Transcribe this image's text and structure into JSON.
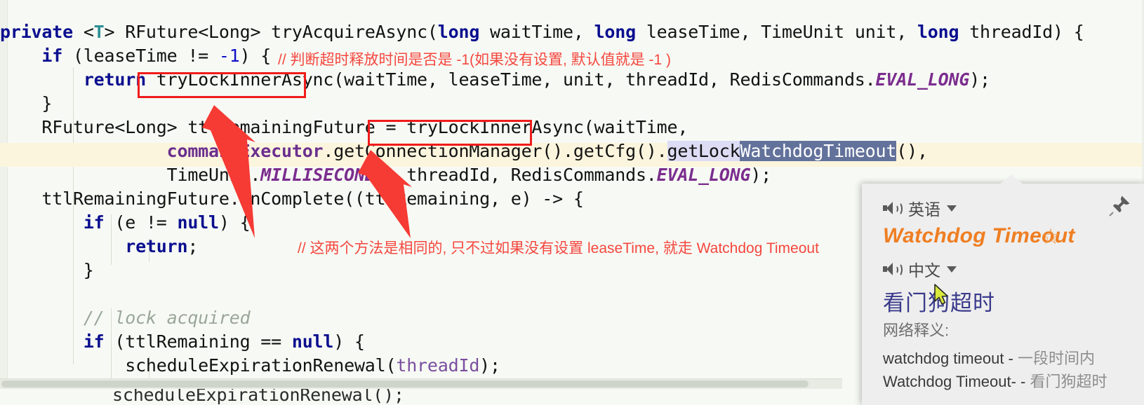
{
  "editor": {
    "language": "java",
    "background_color": "#f7faf4",
    "caret_line_color": "#fcf5dd",
    "lines": [
      {
        "id": "l1",
        "indent": 0,
        "text": "private <T> RFuture<Long> tryAcquireAsync(long waitTime, long leaseTime, TimeUnit unit, long threadId) {"
      },
      {
        "id": "l2",
        "indent": 1,
        "text": "if (leaseTime != -1) {"
      },
      {
        "id": "l3",
        "indent": 2,
        "text": "return tryLockInnerAsync(waitTime, leaseTime, unit, threadId, RedisCommands.EVAL_LONG);"
      },
      {
        "id": "l4",
        "indent": 1,
        "text": "}"
      },
      {
        "id": "l5",
        "indent": 1,
        "text": "RFuture<Long> ttlRemainingFuture = tryLockInnerAsync(waitTime,"
      },
      {
        "id": "l6",
        "indent": 5,
        "text": "commandExecutor.getConnectionManager().getCfg().getLockWatchdogTimeout(),",
        "highlighted": true
      },
      {
        "id": "l7",
        "indent": 5,
        "text": "TimeUnit.MILLISECONDS, threadId, RedisCommands.EVAL_LONG);"
      },
      {
        "id": "l8",
        "indent": 1,
        "text": "ttlRemainingFuture.onComplete((ttlRemaining, e) -> {"
      },
      {
        "id": "l9",
        "indent": 2,
        "text": "if (e != null) {"
      },
      {
        "id": "l10",
        "indent": 3,
        "text": "return;"
      },
      {
        "id": "l11",
        "indent": 2,
        "text": "}"
      },
      {
        "id": "l12",
        "indent": 2,
        "text": "// lock acquired"
      },
      {
        "id": "l13",
        "indent": 2,
        "text": "if (ttlRemaining == null) {"
      },
      {
        "id": "l14",
        "indent": 3,
        "text": "scheduleExpirationRenewal(threadId);"
      },
      {
        "id": "l15",
        "indent": 3,
        "text": "scheduleExpirationRenewal();"
      }
    ],
    "selected_text": "WatchdogTimeout",
    "soft_highlight_text": "getLock",
    "selection_color": "#63729b",
    "soft_highlight_color": "#dcdcf4"
  },
  "annotations": {
    "comment_inline": "// 判断超时释放时间是否是 -1(如果没有设置, 默认值就是 -1 )",
    "comment_note": "// 这两个方法是相同的, 只不过如果没有设置 leaseTime, 就走 Watchdog Timeout",
    "annotation_color": "#f4473f",
    "boxed_token_1": "tryLockInnerAsync",
    "boxed_token_2": "tryLockInnerAsync",
    "arrow_count": 2
  },
  "popup": {
    "source_language": "英语",
    "target_language": "中文",
    "headword": "Watchdog Timeout",
    "headword_color": "#ef7e22",
    "translation": "看门狗超时",
    "network_definition_label": "网络释义:",
    "network_definitions": [
      {
        "term": "watchdog timeout -",
        "meaning": "一段时间内"
      },
      {
        "term": "Watchdog Timeout- -",
        "meaning": "看门狗超时"
      }
    ],
    "star_icon": "☆",
    "pin_icon": "pushpin",
    "speaker_icon": "speaker",
    "background_color": "#eeeeee"
  },
  "scrollbar": {
    "orientation": "horizontal",
    "visible": true
  }
}
